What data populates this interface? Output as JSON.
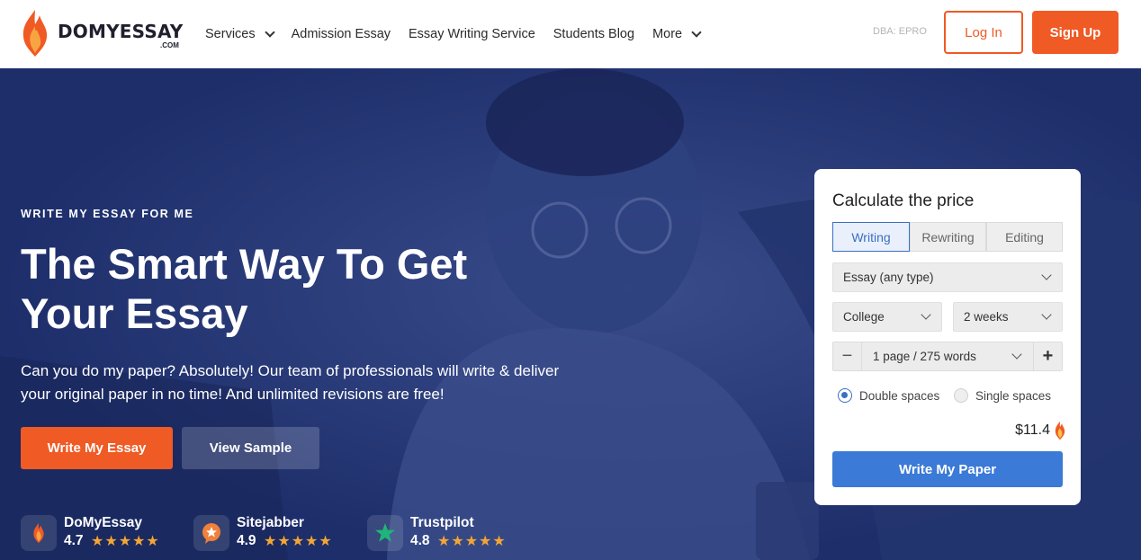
{
  "brand": {
    "name": "DOMYESSAY",
    "suffix": ".COM"
  },
  "nav": {
    "items": [
      {
        "label": "Services",
        "dropdown": true
      },
      {
        "label": "Admission Essay",
        "dropdown": false
      },
      {
        "label": "Essay Writing Service",
        "dropdown": false
      },
      {
        "label": "Students Blog",
        "dropdown": false
      },
      {
        "label": "More",
        "dropdown": true
      }
    ],
    "dba": "DBA: EPRO",
    "login_label": "Log In",
    "signup_label": "Sign Up"
  },
  "hero": {
    "eyebrow": "WRITE MY ESSAY FOR ME",
    "headline": "The Smart Way To Get Your Essay",
    "subtext": "Can you do my paper? Absolutely! Our team of professionals will write & deliver your original paper in no time! And unlimited revisions are free!",
    "primary_cta": "Write My Essay",
    "secondary_cta": "View Sample"
  },
  "reviews": [
    {
      "name": "DoMyEssay",
      "score": "4.7",
      "stars": 5,
      "icon": "domyessay-flame-icon"
    },
    {
      "name": "Sitejabber",
      "score": "4.9",
      "stars": 5,
      "icon": "sitejabber-icon"
    },
    {
      "name": "Trustpilot",
      "score": "4.8",
      "stars": 5,
      "icon": "trustpilot-star-icon"
    }
  ],
  "calculator": {
    "title": "Calculate the price",
    "tabs": [
      {
        "label": "Writing",
        "active": true
      },
      {
        "label": "Rewriting",
        "active": false
      },
      {
        "label": "Editing",
        "active": false
      }
    ],
    "paper_type": "Essay (any type)",
    "level": "College",
    "deadline": "2 weeks",
    "pages": "1 page / 275 words",
    "spacing": [
      {
        "label": "Double spaces",
        "selected": true
      },
      {
        "label": "Single spaces",
        "selected": false
      }
    ],
    "price": "$11.4",
    "cta": "Write My Paper"
  },
  "colors": {
    "accent": "#f05a24",
    "hero_bg": "#1d2e6b",
    "calc_button": "#3b7ad6",
    "star": "#f3a635"
  }
}
